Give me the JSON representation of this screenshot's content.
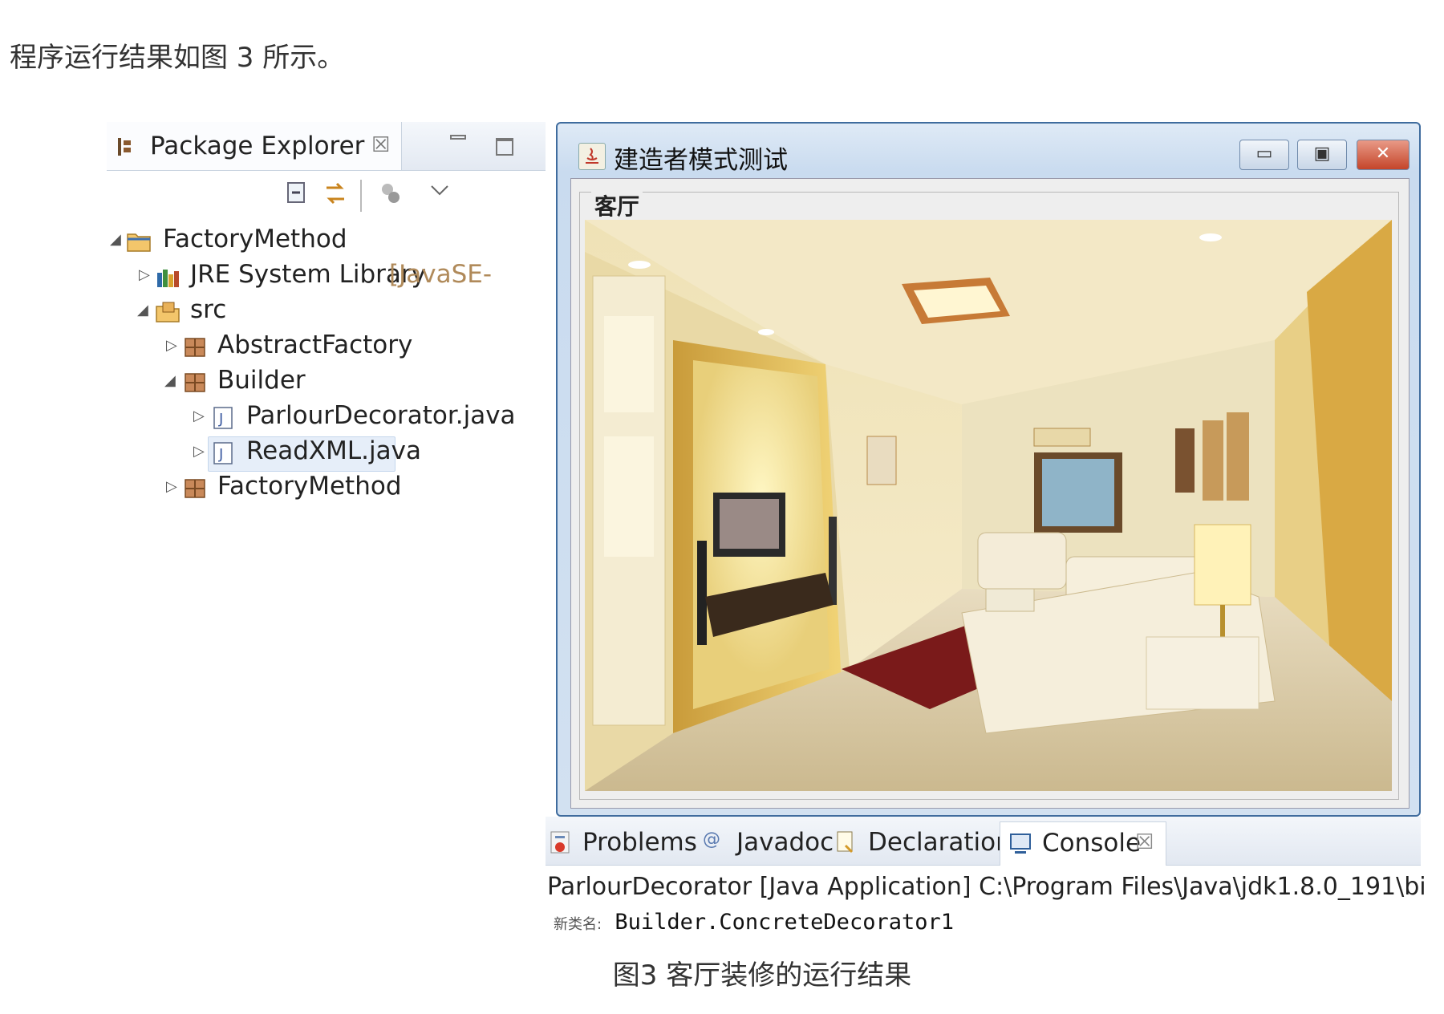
{
  "intro_text": "程序运行结果如图 3 所示。",
  "caption": "图3 客厅装修的运行结果",
  "package_explorer": {
    "title": "Package Explorer",
    "close_glyph": "☒",
    "tree": [
      {
        "label": "FactoryMethod",
        "icon": "project-folder-icon"
      },
      {
        "label": "JRE System Library",
        "suffix": "[JavaSE-",
        "icon": "library-icon"
      },
      {
        "label": "src",
        "icon": "source-folder-icon"
      },
      {
        "label": "AbstractFactory",
        "icon": "package-icon"
      },
      {
        "label": "Builder",
        "icon": "package-icon"
      },
      {
        "label": "ParlourDecorator.java",
        "icon": "java-file-icon"
      },
      {
        "label": "ReadXML.java",
        "icon": "java-file-icon"
      },
      {
        "label": "FactoryMethod",
        "icon": "package-icon"
      }
    ]
  },
  "java_window": {
    "title": "建造者模式测试",
    "group_title": "客厅",
    "image_subject": "living-room-render"
  },
  "views": {
    "tabs": [
      {
        "label": "Problems",
        "icon": "problems-icon"
      },
      {
        "label": "Javadoc",
        "icon": "javadoc-icon"
      },
      {
        "label": "Declaration",
        "icon": "declaration-icon"
      },
      {
        "label": "Console",
        "icon": "console-icon",
        "active": true
      }
    ],
    "close_glyph": "☒",
    "console_header": "ParlourDecorator [Java Application] C:\\Program Files\\Java\\jdk1.8.0_191\\bi",
    "console_prefix": "新类名:",
    "console_output": "Builder.ConcreteDecorator1"
  }
}
